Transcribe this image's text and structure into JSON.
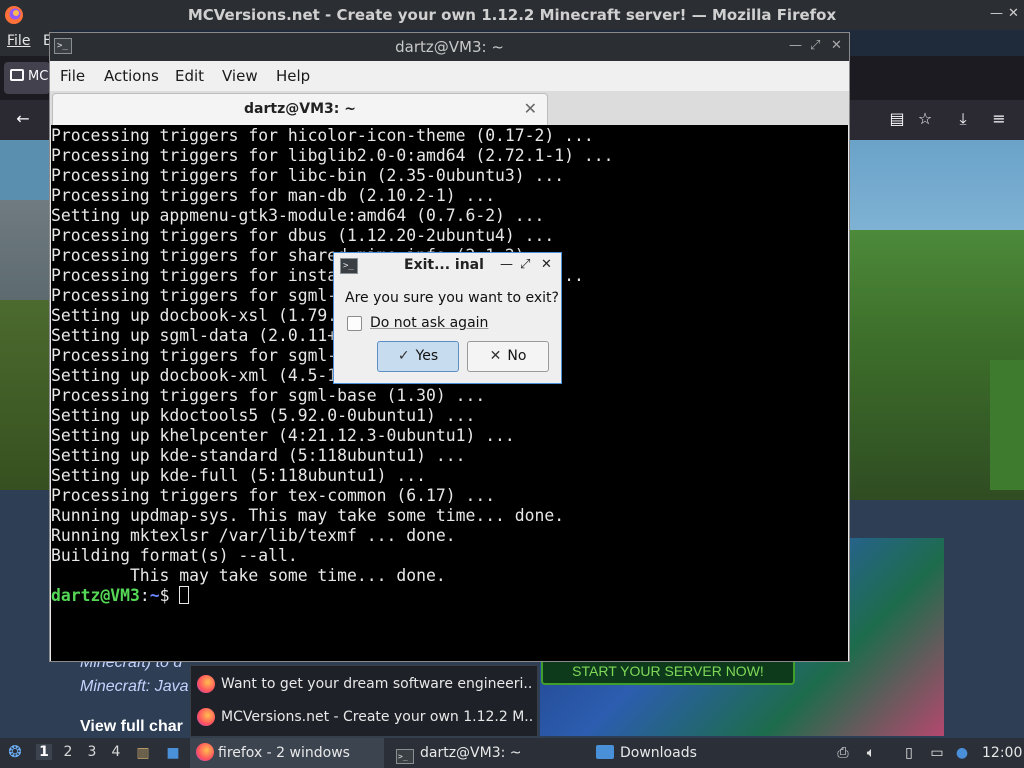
{
  "firefox": {
    "window_title": "MCVersions.net - Create your own 1.12.2 Minecraft server! — Mozilla Firefox",
    "menu_file": "File",
    "menu_edit_partial": "E",
    "tab_label_partial": "MC",
    "popup_items": [
      "Want to get your dream software engineeri...",
      "MCVersions.net - Create your own 1.12.2 M..."
    ],
    "page": {
      "text_minecraft_partial": "Minecraft) to d",
      "text_java_partial": "Minecraft: Java",
      "text_view_full": "View full char",
      "promo_button": "START YOUR SERVER NOW!"
    }
  },
  "terminal": {
    "window_title": "dartz@VM3: ~",
    "menu": [
      "File",
      "Actions",
      "Edit",
      "View",
      "Help"
    ],
    "tab_title": "dartz@VM3: ~",
    "lines": [
      "Processing triggers for hicolor-icon-theme (0.17-2) ...",
      "Processing triggers for libglib2.0-0:amd64 (2.72.1-1) ...",
      "Processing triggers for libc-bin (2.35-0ubuntu3) ...",
      "Processing triggers for man-db (2.10.2-1) ...",
      "Setting up appmenu-gtk3-module:amd64 (0.7.6-2) ...",
      "Processing triggers for dbus (1.12.20-2ubuntu4) ...",
      "Processing triggers for shared-mime-info (2.1-2) ...",
      "Processing triggers for install-info (6.8-4build1) ...",
      "Processing triggers for sgml-base (1.30) ...",
      "Setting up docbook-xsl (1.79.2+dfsg-1) ...",
      "Setting up sgml-data (2.0.11+nmu1) ...",
      "Processing triggers for sgml-base (1.30) ...",
      "Setting up docbook-xml (4.5-11) ...",
      "Processing triggers for sgml-base (1.30) ...",
      "Setting up kdoctools5 (5.92.0-0ubuntu1) ...",
      "Setting up khelpcenter (4:21.12.3-0ubuntu1) ...",
      "Setting up kde-standard (5:118ubuntu1) ...",
      "Setting up kde-full (5:118ubuntu1) ...",
      "Processing triggers for tex-common (6.17) ...",
      "Running updmap-sys. This may take some time... done.",
      "Running mktexlsr /var/lib/texmf ... done.",
      "Building format(s) --all.",
      "        This may take some time... done."
    ],
    "prompt_user": "dartz@VM3",
    "prompt_sep": ":",
    "prompt_path": "~",
    "prompt_symbol": "$ "
  },
  "exit_dialog": {
    "title": "Exit... inal",
    "question": "Are you sure you want to exit?",
    "checkbox_label": "Do not ask again",
    "checkbox_checked": false,
    "yes_label": "Yes",
    "no_label": "No"
  },
  "taskbar": {
    "workspaces": [
      "1",
      "2",
      "3",
      "4"
    ],
    "active_workspace": "1",
    "firefox_task": "firefox - 2 windows",
    "terminal_task": "dartz@VM3: ~",
    "downloads_task": "Downloads",
    "clock": "12:00"
  },
  "colors": {
    "prompt_user": "#55d855",
    "prompt_path": "#6b86ff",
    "dialog_accent": "#4a90d9"
  }
}
